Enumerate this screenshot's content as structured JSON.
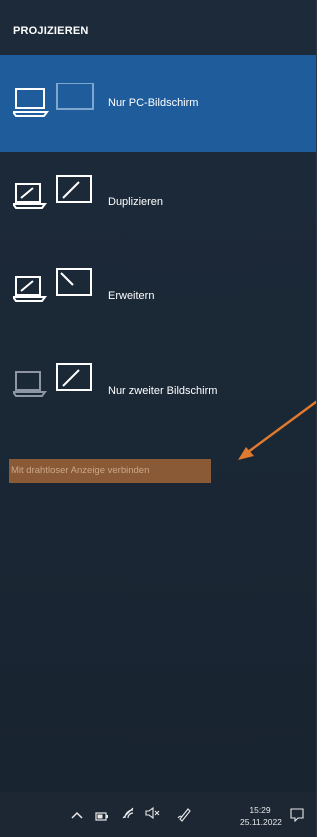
{
  "panel": {
    "title": "PROJIZIEREN"
  },
  "options": [
    {
      "label": "Nur PC-Bildschirm",
      "icon": "pc-screen-only-icon",
      "selected": true
    },
    {
      "label": "Duplizieren",
      "icon": "duplicate-icon",
      "selected": false
    },
    {
      "label": "Erweitern",
      "icon": "extend-icon",
      "selected": false
    },
    {
      "label": "Nur zweiter Bildschirm",
      "icon": "second-screen-only-icon",
      "selected": false
    }
  ],
  "wireless": {
    "label": "Mit drahtloser Anzeige verbinden"
  },
  "taskbar": {
    "time": "15:29",
    "date": "25.11.2022",
    "icons": [
      "chevron-up-icon",
      "battery-icon",
      "wifi-icon",
      "volume-muted-icon",
      "pen-icon",
      "notification-icon"
    ]
  },
  "colors": {
    "accent": "#1e5c9c",
    "highlight": "#8a5a36",
    "arrow": "#e07a2e"
  }
}
